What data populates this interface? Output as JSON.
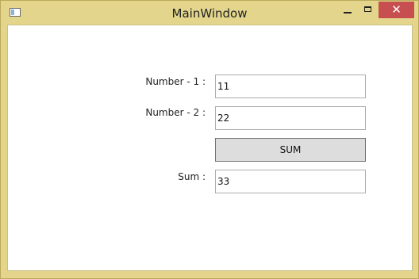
{
  "window": {
    "title": "MainWindow",
    "icons": {
      "app": "window-app-icon",
      "minimize": "minimize-icon",
      "maximize": "maximize-icon",
      "close": "close-icon"
    },
    "close_glyph": "✕",
    "colors": {
      "frame": "#e3d68c",
      "close_button": "#c74f50"
    }
  },
  "form": {
    "number1_label": "Number - 1 :",
    "number1_value": "11",
    "number2_label": "Number - 2 :",
    "number2_value": "22",
    "sum_button_label": "SUM",
    "sum_label": "Sum :",
    "sum_value": "33"
  }
}
